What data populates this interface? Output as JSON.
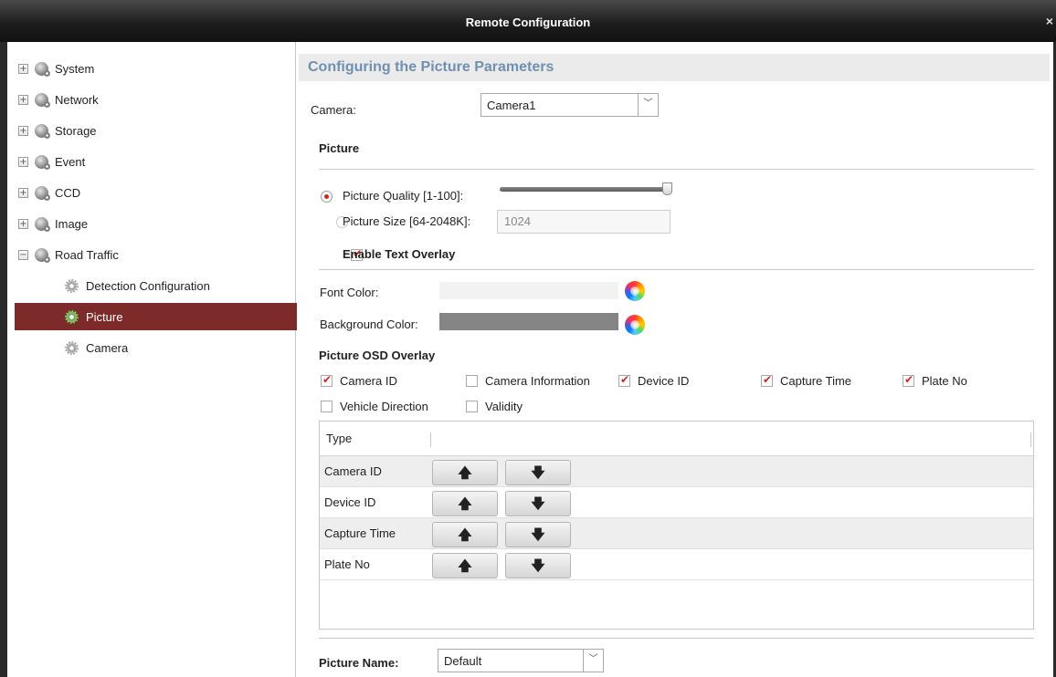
{
  "window": {
    "title": "Remote Configuration",
    "close_glyph": "×"
  },
  "sidebar": {
    "items": [
      {
        "label": "System",
        "expander": "+"
      },
      {
        "label": "Network",
        "expander": "+"
      },
      {
        "label": "Storage",
        "expander": "+"
      },
      {
        "label": "Event",
        "expander": "+"
      },
      {
        "label": "CCD",
        "expander": "+"
      },
      {
        "label": "Image",
        "expander": "+"
      },
      {
        "label": "Road Traffic",
        "expander": "−"
      }
    ],
    "children": [
      {
        "label": "Detection Configuration",
        "selected": false
      },
      {
        "label": "Picture",
        "selected": true
      },
      {
        "label": "Camera",
        "selected": false
      }
    ]
  },
  "main": {
    "header": "Configuring the Picture Parameters",
    "camera": {
      "label": "Camera:",
      "value": "Camera1"
    },
    "picture": {
      "heading": "Picture",
      "quality_label": "Picture Quality [1-100]:",
      "quality_value": 100,
      "size_label": "Picture Size [64-2048K]:",
      "size_value": "1024",
      "selected_mode": "quality"
    },
    "text_overlay": {
      "label": "Enable Text Overlay",
      "checked": true
    },
    "font_color": {
      "label": "Font Color:",
      "color": "#f2f2f2"
    },
    "background_color": {
      "label": "Background Color:",
      "color": "#858585"
    },
    "osd": {
      "heading": "Picture OSD Overlay",
      "items": [
        {
          "label": "Camera ID",
          "checked": true
        },
        {
          "label": "Camera Information",
          "checked": false
        },
        {
          "label": "Device ID",
          "checked": true
        },
        {
          "label": "Capture Time",
          "checked": true
        },
        {
          "label": "Plate No",
          "checked": true
        },
        {
          "label": "Vehicle Direction",
          "checked": false
        },
        {
          "label": "Validity",
          "checked": false
        }
      ]
    },
    "table": {
      "column": "Type",
      "up_glyph": "🡅",
      "down_glyph": "🡇",
      "rows": [
        "Camera ID",
        "Device ID",
        "Capture Time",
        "Plate No"
      ]
    },
    "picture_name": {
      "label": "Picture Name:",
      "value": "Default"
    }
  },
  "colors": {
    "accent_header": "#6f8fb3",
    "selected_row": "#7d2a2a",
    "check_red": "#d0261b"
  }
}
